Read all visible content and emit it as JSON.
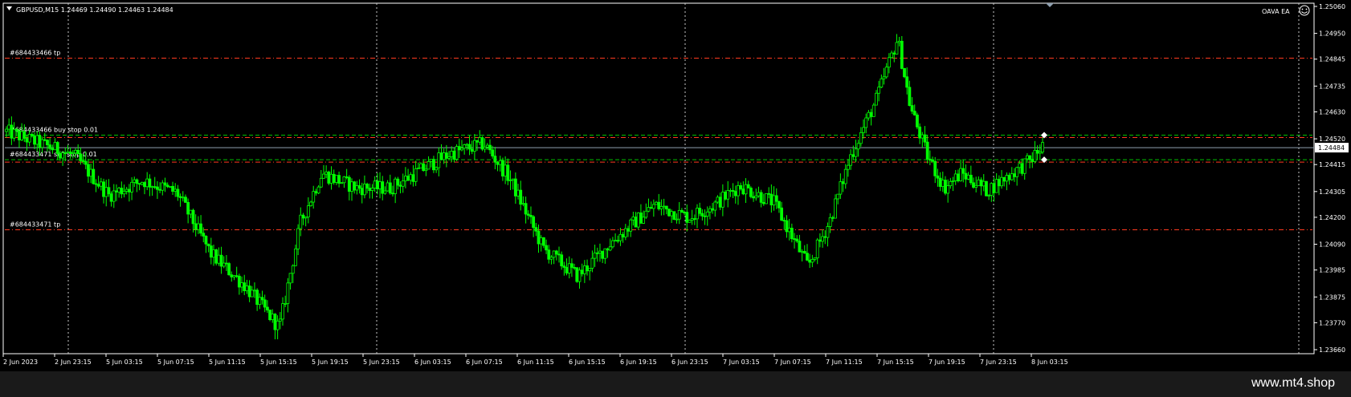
{
  "header": {
    "symbol_info": "GBPUSD,M15  1.24469 1.24490 1.24463 1.24484",
    "ea_label": "OAVA EA",
    "smiley_icon": "smiley-face-icon",
    "collapse_icon": "triangle-down-icon"
  },
  "footer": {
    "site": "www.mt4.shop"
  },
  "colors": {
    "background": "#000000",
    "candle": "#00ff00",
    "tp_line": "#ff3b1f",
    "order_line": "#00c000",
    "current_line": "#8fa0b0",
    "grid": "#c8c8c8",
    "axis_text": "#ffffff"
  },
  "chart_data": {
    "type": "candlestick",
    "symbol": "GBPUSD",
    "timeframe": "M15",
    "ylim": [
      1.2366,
      1.2506
    ],
    "y_ticks": [
      "1.25060",
      "1.24950",
      "1.24845",
      "1.24735",
      "1.24630",
      "1.24520",
      "1.24415",
      "1.24305",
      "1.24200",
      "1.24090",
      "1.23985",
      "1.23875",
      "1.23770",
      "1.23660"
    ],
    "x_ticks": [
      "2 Jun 2023",
      "2 Jun 23:15",
      "5 Jun 03:15",
      "5 Jun 07:15",
      "5 Jun 11:15",
      "5 Jun 15:15",
      "5 Jun 19:15",
      "5 Jun 23:15",
      "6 Jun 03:15",
      "6 Jun 07:15",
      "6 Jun 11:15",
      "6 Jun 15:15",
      "6 Jun 19:15",
      "6 Jun 23:15",
      "7 Jun 03:15",
      "7 Jun 07:15",
      "7 Jun 11:15",
      "7 Jun 15:15",
      "7 Jun 19:15",
      "7 Jun 23:15",
      "8 Jun 03:15"
    ],
    "day_separators": [
      "2 Jun 23:15",
      "5 Jun 23:15",
      "6 Jun 23:15",
      "7 Jun 23:15"
    ],
    "current_price": {
      "value": 1.24484,
      "label": "1.24484"
    },
    "levels": [
      {
        "label": "#684433466 tp",
        "price": 1.24849,
        "kind": "tp"
      },
      {
        "label": "#684433466 buy stop 0.01",
        "price": 1.24535,
        "kind": "order"
      },
      {
        "label": "#684433471 sell stop 0.01",
        "price": 1.24435,
        "kind": "order"
      },
      {
        "label": "#684433471 tp",
        "price": 1.24149,
        "kind": "tp"
      }
    ],
    "price_path": [
      [
        0,
        1.2455
      ],
      [
        40,
        1.245
      ],
      [
        80,
        1.2445
      ],
      [
        120,
        1.2429
      ],
      [
        160,
        1.2435
      ],
      [
        200,
        1.243
      ],
      [
        240,
        1.2405
      ],
      [
        280,
        1.2392
      ],
      [
        320,
        1.2375
      ],
      [
        345,
        1.2418
      ],
      [
        370,
        1.2438
      ],
      [
        410,
        1.2432
      ],
      [
        450,
        1.2432
      ],
      [
        490,
        1.244
      ],
      [
        520,
        1.2446
      ],
      [
        560,
        1.245
      ],
      [
        590,
        1.2436
      ],
      [
        630,
        1.2407
      ],
      [
        670,
        1.2396
      ],
      [
        710,
        1.241
      ],
      [
        760,
        1.2425
      ],
      [
        800,
        1.242
      ],
      [
        830,
        1.2425
      ],
      [
        860,
        1.2433
      ],
      [
        900,
        1.2426
      ],
      [
        940,
        1.24
      ],
      [
        965,
        1.2418
      ],
      [
        990,
        1.2445
      ],
      [
        1020,
        1.2468
      ],
      [
        1045,
        1.2493
      ],
      [
        1060,
        1.2465
      ],
      [
        1080,
        1.2445
      ],
      [
        1100,
        1.2432
      ],
      [
        1120,
        1.2438
      ],
      [
        1150,
        1.2431
      ],
      [
        1175,
        1.2437
      ],
      [
        1200,
        1.2443
      ],
      [
        1215,
        1.2449
      ]
    ]
  }
}
